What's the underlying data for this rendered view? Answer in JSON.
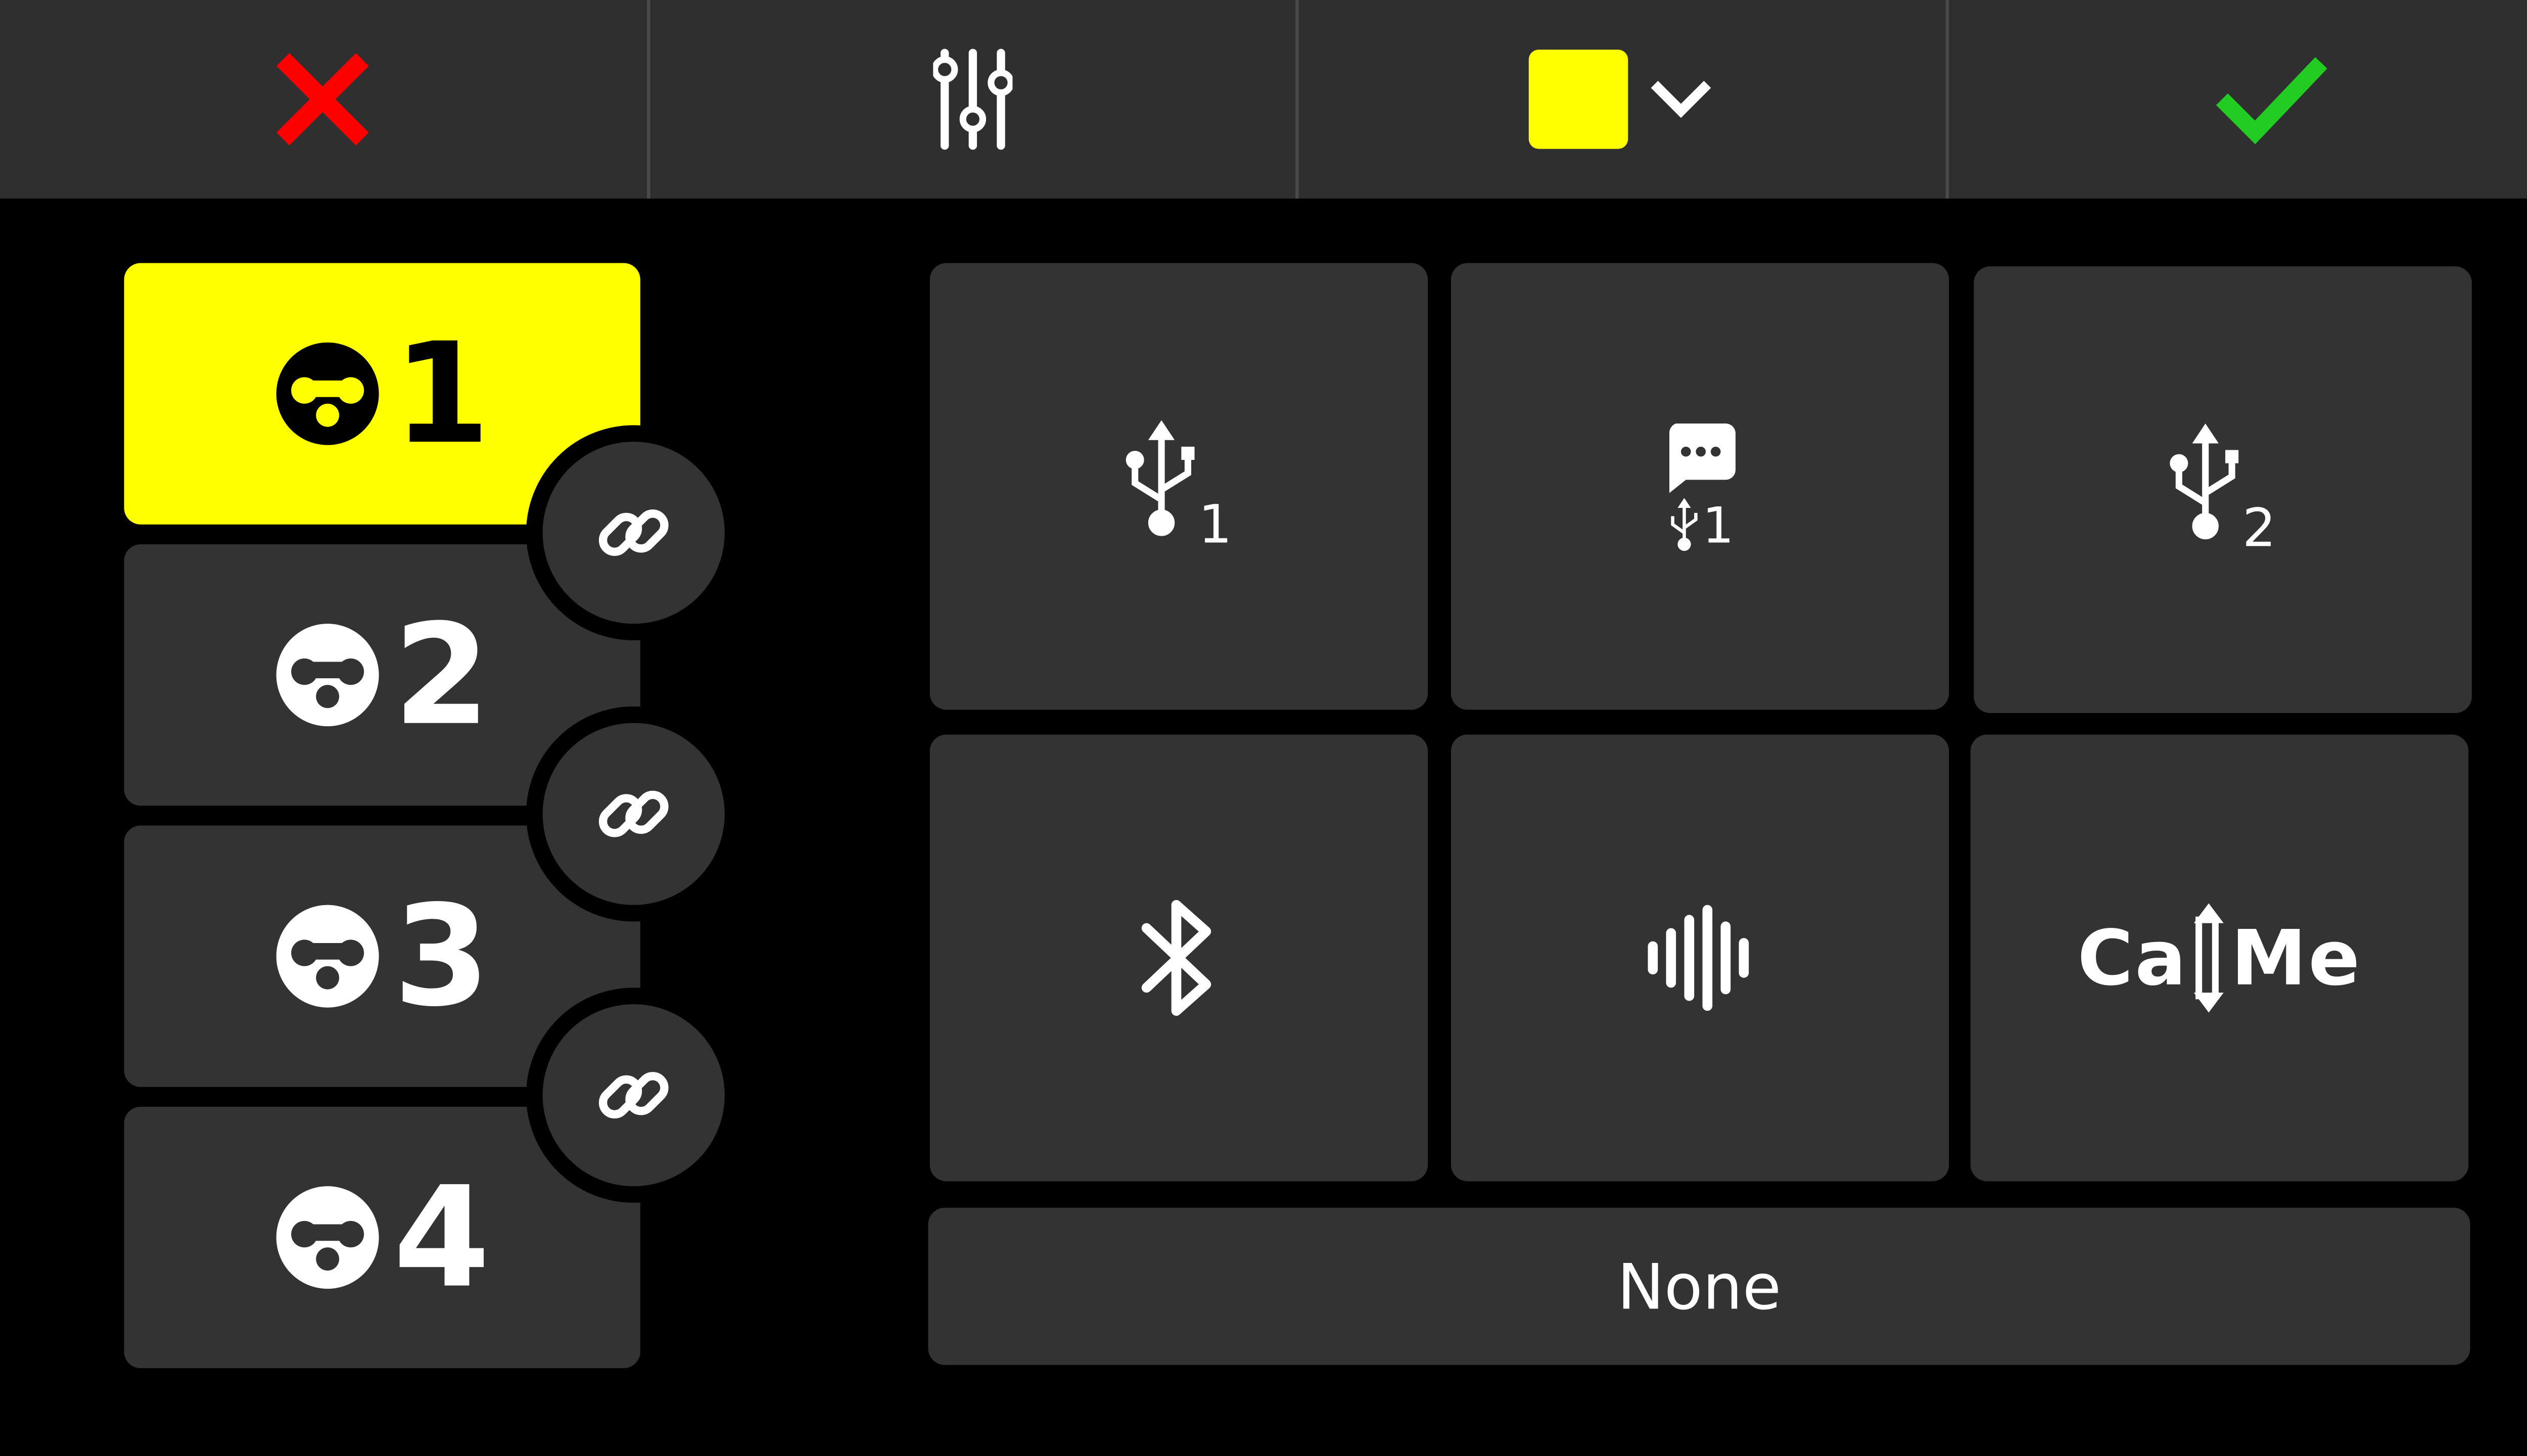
{
  "topbar": {
    "cancel_icon": "close-x-icon",
    "mixer_icon": "sliders-icon",
    "color": {
      "value": "#ffff00",
      "icon": "chevron-down-icon"
    },
    "confirm_icon": "checkmark-icon"
  },
  "colors": {
    "cancel": "#ff0000",
    "confirm": "#22cc22",
    "selected_channel": "#ffff00",
    "button_bg": "#333333"
  },
  "channels": [
    {
      "number": "1",
      "icon": "headset-mic-icon",
      "active": true
    },
    {
      "number": "2",
      "icon": "headset-mic-icon",
      "active": false
    },
    {
      "number": "3",
      "icon": "headset-mic-icon",
      "active": false
    },
    {
      "number": "4",
      "icon": "headset-mic-icon",
      "active": false
    }
  ],
  "links": [
    {
      "icon": "link-icon"
    },
    {
      "icon": "link-icon"
    },
    {
      "icon": "link-icon"
    }
  ],
  "sources": [
    {
      "icon": "usb-icon",
      "subscript": "1"
    },
    {
      "icon": "chat-usb-icon",
      "subscript": "1"
    },
    {
      "icon": "usb-icon",
      "subscript": "2"
    },
    {
      "icon": "bluetooth-icon"
    },
    {
      "icon": "audio-wave-icon"
    },
    {
      "icon": "callme-icon",
      "label_left": "Ca",
      "label_right": "Me"
    }
  ],
  "none_label": "None"
}
